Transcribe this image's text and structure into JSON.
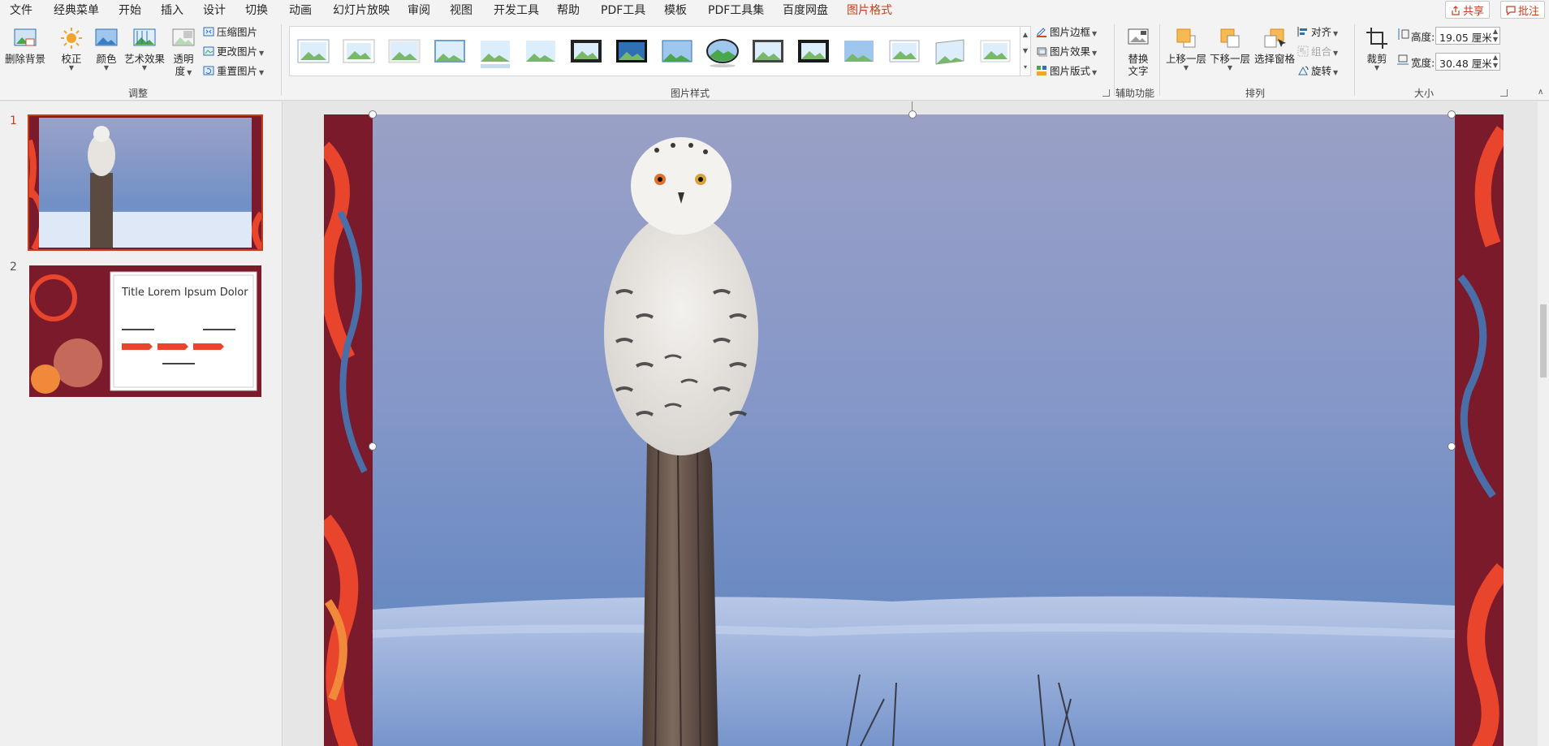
{
  "menu": {
    "tabs": [
      "文件",
      "经典菜单",
      "开始",
      "插入",
      "设计",
      "切换",
      "动画",
      "幻灯片放映",
      "审阅",
      "视图",
      "开发工具",
      "帮助",
      "PDF工具",
      "模板",
      "PDF工具集",
      "百度网盘",
      "图片格式"
    ],
    "share_label": "共享",
    "comment_label": "批注"
  },
  "ribbon": {
    "adjust": {
      "remove_bg": "删除背景",
      "correct": "校正",
      "color": "颜色",
      "artistic": "艺术效果",
      "transparency_1": "透明",
      "transparency_2": "度",
      "compress": "压缩图片",
      "change": "更改图片",
      "reset": "重置图片",
      "group_label": "调整"
    },
    "styles": {
      "group_label": "图片样式",
      "border": "图片边框",
      "effects": "图片效果",
      "layout": "图片版式"
    },
    "accessibility": {
      "alt_text_1": "替换",
      "alt_text_2": "文字",
      "group_label": "辅助功能"
    },
    "arrange": {
      "bring_forward": "上移一层",
      "send_backward": "下移一层",
      "selection_pane": "选择窗格",
      "align": "对齐",
      "group": "组合",
      "rotate": "旋转",
      "group_label": "排列"
    },
    "size": {
      "crop": "裁剪",
      "height_label": "高度:",
      "height_value": "19.05 厘米",
      "width_label": "宽度:",
      "width_value": "30.48 厘米",
      "group_label": "大小"
    }
  },
  "slides": {
    "items": [
      {
        "number": "1"
      },
      {
        "number": "2",
        "title": "Title Lorem Ipsum Dolor"
      }
    ]
  },
  "colors": {
    "accent": "#c43e1c",
    "ribbon_bg": "#f3f3f3",
    "pattern_dark": "#7a1a2a",
    "pattern_red": "#e8452c",
    "sky": "#8fa2cf"
  }
}
